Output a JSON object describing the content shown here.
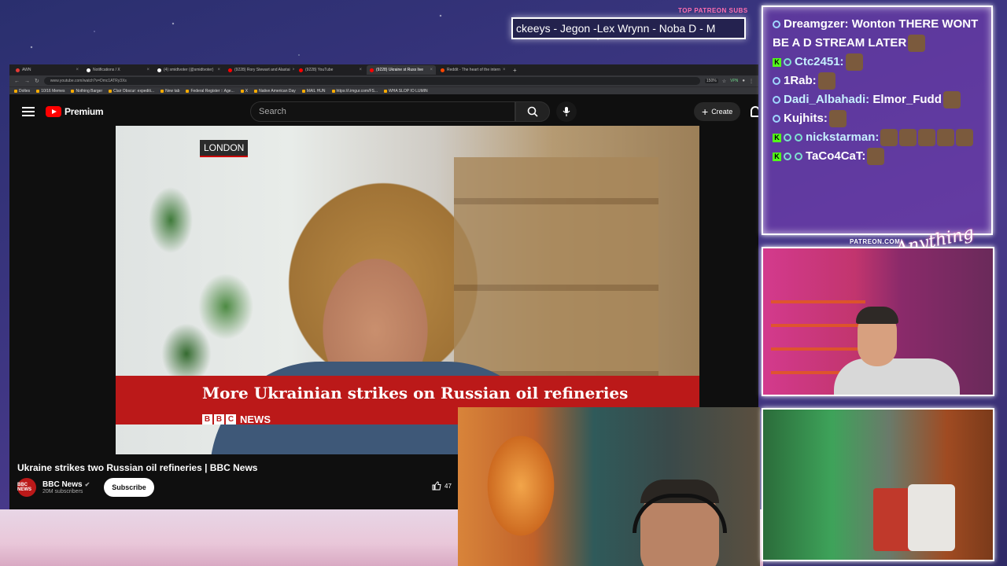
{
  "overlay": {
    "patreon_subs_label": "TOP PATREON SUBS",
    "ticker_text": "ckeeys - Jegon -Lex Wrynn -  Noba D - M",
    "patreon_url": "PATREON.COM/",
    "signature": "Anything Else?"
  },
  "browser": {
    "tabs": [
      {
        "label": "AWN",
        "active": false,
        "icon_color": "#e53935"
      },
      {
        "label": "Notifications / X",
        "active": false,
        "icon_color": "#ffffff"
      },
      {
        "label": "(4) smidtvoter (@smidtvoter)",
        "active": false,
        "icon_color": "#ffffff"
      },
      {
        "label": "(9228) Rory Stewart and Alastai",
        "active": false,
        "icon_color": "#ff0000"
      },
      {
        "label": "(9228) YouTube",
        "active": false,
        "icon_color": "#ff0000"
      },
      {
        "label": "(9228) Ukraine st Russ live",
        "active": true,
        "icon_color": "#ff0000"
      },
      {
        "label": "Reddit - The heart of the intern",
        "active": false,
        "icon_color": "#ff4500"
      }
    ],
    "url": "www.youtube.com/watch?v=Dmc1ATRy3Xs",
    "zoom": "150%",
    "vpn": "VPN",
    "bookmarks": [
      "Doltes",
      "10/16 Memes",
      "Nothing Barger",
      "Clair Obscur: expediti...",
      "New tab",
      "Federal Register :: Age...",
      "X",
      "Native American Day",
      "MAIL HUN",
      "https://i.imgur.com/FS...",
      "WHA SLOP IO LUMIN"
    ]
  },
  "youtube": {
    "brand": "Premium",
    "search_placeholder": "Search",
    "create_label": "Create",
    "video": {
      "location_tag": "LONDON",
      "headline": "More Ukrainian strikes on Russian oil refineries",
      "bbc_letters": [
        "B",
        "B",
        "C"
      ],
      "bbc_news": "NEWS",
      "title": "Ukraine strikes two Russian oil refineries | BBC News"
    },
    "channel": {
      "name": "BBC News",
      "verified": "✔",
      "subscribers": "20M subscribers",
      "avatar_text": "BBC NEWS",
      "subscribe_label": "Subscribe"
    },
    "likes": "47"
  },
  "chat": [
    {
      "badges": [
        "twitch"
      ],
      "user": "Dreamgzer:",
      "text": "Wonton THERE WONT BE A D STREAM LATER",
      "emotes": 1
    },
    {
      "badges": [
        "kick",
        "sub"
      ],
      "user": "Ctc2451:",
      "text": "",
      "emotes": 1
    },
    {
      "badges": [
        "twitch"
      ],
      "user": "1Rab:",
      "text": "",
      "emotes": 1
    },
    {
      "badges": [
        "twitch"
      ],
      "user": "Dadi_Albahadi:",
      "text": "Elmor_Fudd",
      "emotes": 1
    },
    {
      "badges": [
        "twitch"
      ],
      "user": "Kujhits:",
      "text": "",
      "emotes": 1
    },
    {
      "badges": [
        "kick",
        "sub",
        "mod"
      ],
      "user": "nickstarman:",
      "text": "",
      "emotes": 5
    },
    {
      "badges": [
        "kick",
        "sub",
        "mod"
      ],
      "user": "TaCo4CaT:",
      "text": "",
      "emotes": 1
    }
  ]
}
